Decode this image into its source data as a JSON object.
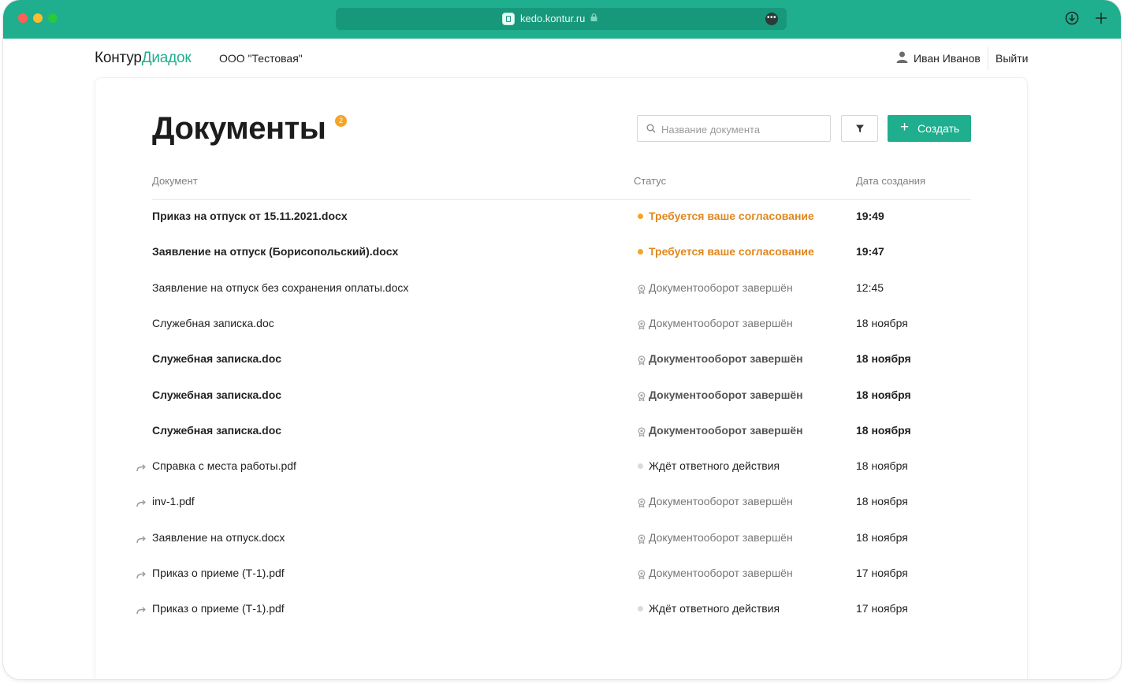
{
  "browser": {
    "url": "kedo.kontur.ru",
    "more_label": "•••"
  },
  "header": {
    "logo_part1": "Контур",
    "logo_part2": "Диадок",
    "organization": "ООО \"Тестовая\"",
    "user_name": "Иван Иванов",
    "logout_label": "Выйти"
  },
  "page": {
    "title": "Документы",
    "badge_count": "2",
    "search_placeholder": "Название документа",
    "create_label": "Создать",
    "columns": {
      "document": "Документ",
      "status": "Статус",
      "date": "Дата создания"
    }
  },
  "colors": {
    "brand_green": "#1fae8e",
    "approval_orange": "#e0871e"
  },
  "rows": [
    {
      "name": "Приказ на отпуск от 15.11.2021.docx",
      "status": "Требуется ваше согласование",
      "status_type": "approval",
      "date": "19:49",
      "bold": true,
      "forwarded": false
    },
    {
      "name": "Заявление на отпуск (Борисопольский).docx",
      "status": "Требуется ваше согласование",
      "status_type": "approval",
      "date": "19:47",
      "bold": true,
      "forwarded": false
    },
    {
      "name": "Заявление на отпуск без сохранения оплаты.docx",
      "status": "Документооборот завершён",
      "status_type": "done",
      "date": "12:45",
      "bold": false,
      "forwarded": false
    },
    {
      "name": "Служебная записка.doc",
      "status": "Документооборот завершён",
      "status_type": "done",
      "date": "18 ноября",
      "bold": false,
      "forwarded": false
    },
    {
      "name": "Служебная записка.doc",
      "status": "Документооборот завершён",
      "status_type": "done",
      "date": "18 ноября",
      "bold": true,
      "forwarded": false
    },
    {
      "name": "Служебная записка.doc",
      "status": "Документооборот завершён",
      "status_type": "done",
      "date": "18 ноября",
      "bold": true,
      "forwarded": false
    },
    {
      "name": "Служебная записка.doc",
      "status": "Документооборот завершён",
      "status_type": "done",
      "date": "18 ноября",
      "bold": true,
      "forwarded": false
    },
    {
      "name": "Справка с места работы.pdf",
      "status": "Ждёт ответного действия",
      "status_type": "wait",
      "date": "18 ноября",
      "bold": false,
      "forwarded": true
    },
    {
      "name": "inv-1.pdf",
      "status": "Документооборот завершён",
      "status_type": "done",
      "date": "18 ноября",
      "bold": false,
      "forwarded": true
    },
    {
      "name": "Заявление на отпуск.docx",
      "status": "Документооборот завершён",
      "status_type": "done",
      "date": "18 ноября",
      "bold": false,
      "forwarded": true
    },
    {
      "name": "Приказ о приеме (Т-1).pdf",
      "status": "Документооборот завершён",
      "status_type": "done",
      "date": "17 ноября",
      "bold": false,
      "forwarded": true
    },
    {
      "name": "Приказ о приеме (Т-1).pdf",
      "status": "Ждёт ответного действия",
      "status_type": "wait",
      "date": "17 ноября",
      "bold": false,
      "forwarded": true
    }
  ]
}
